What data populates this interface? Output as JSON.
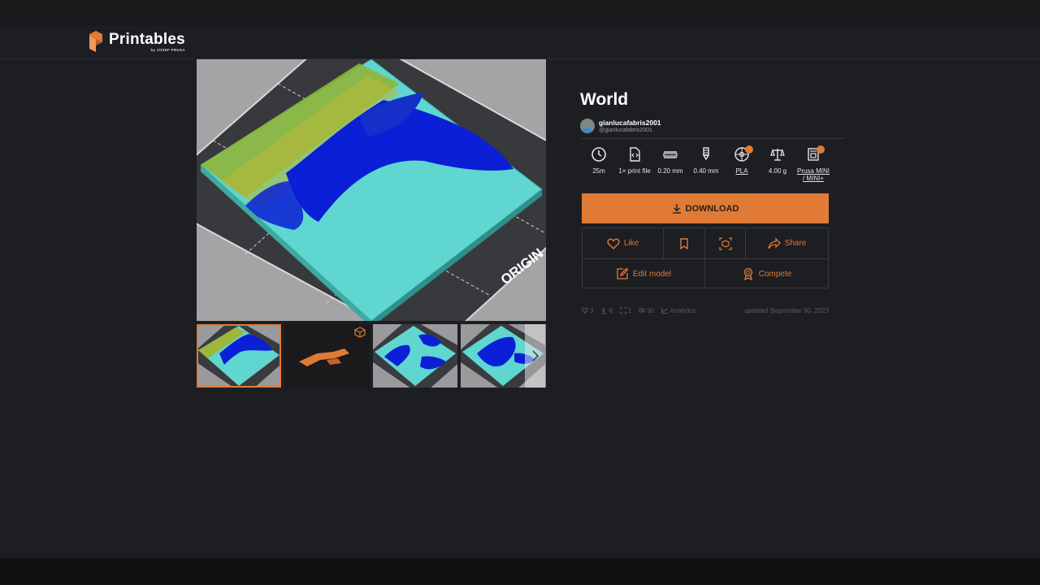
{
  "brand": {
    "name": "Printables",
    "sub": "by JOSEF PRUSA",
    "accent": "#e07a37"
  },
  "model": {
    "title": "World",
    "author_name": "gianlucafabris2001",
    "author_handle": "@gianlucafabris2001"
  },
  "gallery": {
    "main_label": "ORIGIN",
    "thumbnail_count": 4,
    "active_index": 0,
    "next_icon": "chevron-right-icon"
  },
  "params": [
    {
      "icon": "clock-icon",
      "value": "25m"
    },
    {
      "icon": "file-code-icon",
      "value": "1× print file"
    },
    {
      "icon": "layer-height-icon",
      "value": "0.20 mm"
    },
    {
      "icon": "nozzle-icon",
      "value": "0.40 mm"
    },
    {
      "icon": "filament-spool-icon",
      "value": "PLA"
    },
    {
      "icon": "scale-icon",
      "value": "4.00 g"
    },
    {
      "icon": "printer-icon",
      "value": "Prusa MINI / MINI+"
    }
  ],
  "actions": {
    "download": "DOWNLOAD",
    "like": "Like",
    "share": "Share",
    "edit": "Edit model",
    "compete": "Compete"
  },
  "stats": {
    "likes": "3",
    "downloads": "6",
    "makes": "1",
    "views": "90",
    "analytics": "Analytics",
    "updated": "updated September 30, 2023"
  }
}
